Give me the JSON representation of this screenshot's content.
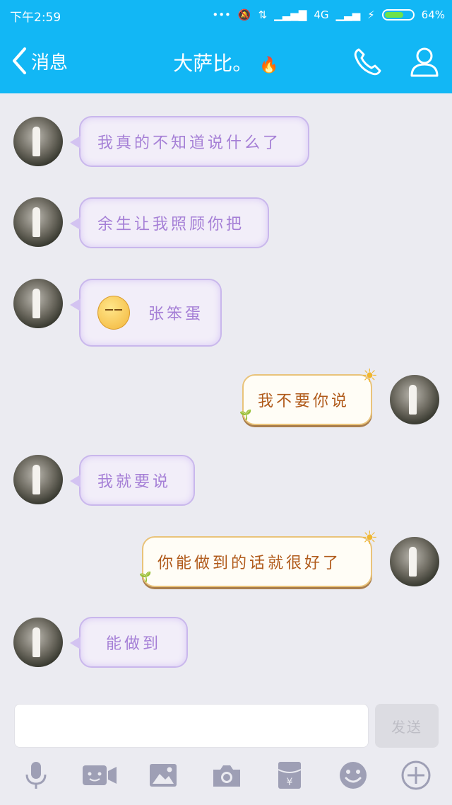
{
  "status_bar": {
    "time": "下午2:59",
    "network": "4G",
    "battery": "64%"
  },
  "header": {
    "back_label": "消息",
    "title": "大萨比。",
    "phone_icon": "phone-icon",
    "profile_icon": "profile-icon"
  },
  "messages": [
    {
      "side": "left",
      "text": "我真的不知道说什么了"
    },
    {
      "side": "left",
      "text": "余生让我照顾你把"
    },
    {
      "side": "left",
      "text": "张笨蛋",
      "emoji": "smile-emoji"
    },
    {
      "side": "right",
      "text": "我不要你说"
    },
    {
      "side": "left",
      "text": "我就要说"
    },
    {
      "side": "right",
      "text": "你能做到的话就很好了"
    },
    {
      "side": "left",
      "text": "能做到"
    }
  ],
  "composer": {
    "placeholder": "",
    "send_label": "发送"
  },
  "toolbar": [
    "mic-icon",
    "video-icon",
    "image-icon",
    "camera-icon",
    "red-packet-icon",
    "emoji-icon",
    "plus-icon"
  ],
  "colors": {
    "header": "#12b7f5",
    "background": "#ebebf1",
    "left_bubble_text": "#a57fd6",
    "right_bubble_text": "#b05a1a"
  }
}
